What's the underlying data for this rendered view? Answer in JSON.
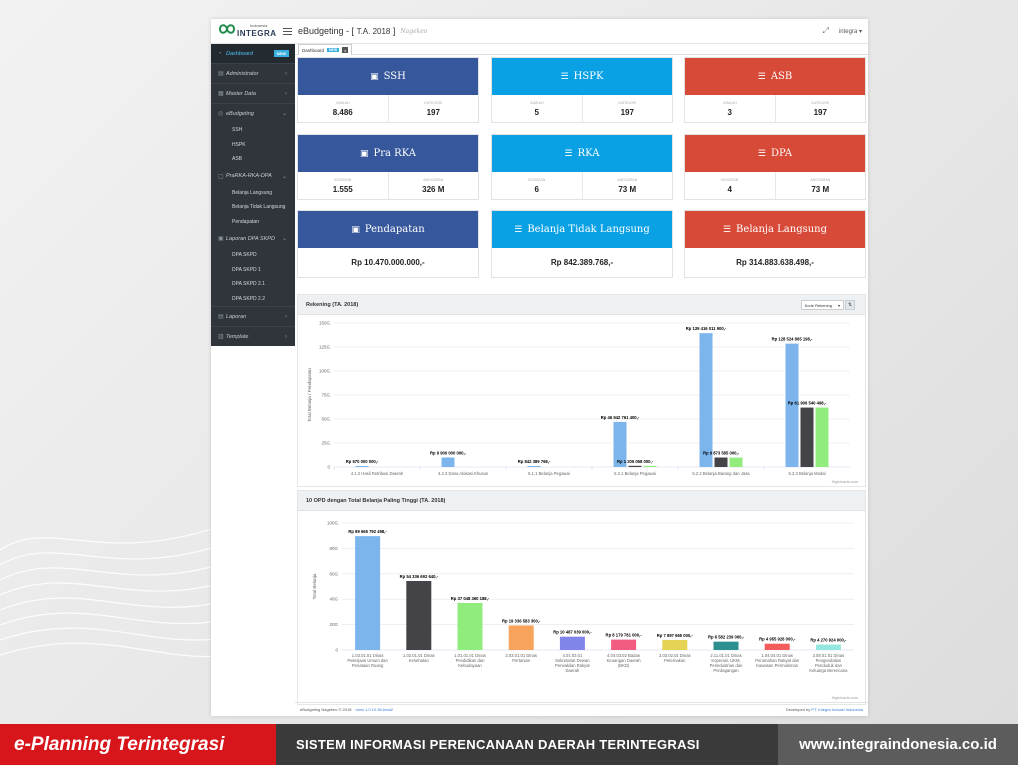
{
  "header": {
    "logo_top": "Indonesia",
    "logo_name": "INTEGRA",
    "title": "eBudgeting - [",
    "title_ta": "T.A. 2018",
    "title_close": "]",
    "subtitle": "Nagekeo",
    "user": "integra"
  },
  "sidebar": {
    "items": [
      {
        "label": "Dashboard",
        "badge": "NEW"
      },
      {
        "label": "Administrator"
      },
      {
        "label": "Master Data"
      },
      {
        "label": "eBudgeting"
      },
      {
        "label": "SSH"
      },
      {
        "label": "HSPK"
      },
      {
        "label": "ASB"
      },
      {
        "label": "PraRKA-RKA-DPA"
      },
      {
        "label": "Belanja Langsung"
      },
      {
        "label": "Belanja Tidak Langsung"
      },
      {
        "label": "Pendapatan"
      },
      {
        "label": "Laporan DPA SKPD"
      },
      {
        "label": "DPA SKPD"
      },
      {
        "label": "DPA SKPD 1"
      },
      {
        "label": "DPA SKPD 2.1"
      },
      {
        "label": "DPA SKPD 2.2"
      },
      {
        "label": "Laporan"
      },
      {
        "label": "Template"
      }
    ]
  },
  "tabs": [
    {
      "label": "Dashboard",
      "badge": "NEW",
      "close": "x"
    }
  ],
  "cards": [
    {
      "title": "SSH",
      "color": "#36579b",
      "left_label": "JUMLAH",
      "left_value": "8.486",
      "right_label": "KATEGORI",
      "right_value": "197"
    },
    {
      "title": "HSPK",
      "color": "#0aa1e4",
      "left_label": "JUMLAH",
      "left_value": "5",
      "right_label": "KATEGORI",
      "right_value": "197"
    },
    {
      "title": "ASB",
      "color": "#d84a38",
      "left_label": "JUMLAH",
      "left_value": "3",
      "right_label": "KATEGORI",
      "right_value": "197"
    },
    {
      "title": "Pra RKA",
      "color": "#36579b",
      "left_label": "KEGIATAN",
      "left_value": "1.555",
      "right_label": "ANGGARAN",
      "right_value": "326 M"
    },
    {
      "title": "RKA",
      "color": "#0aa1e4",
      "left_label": "KEGIATAN",
      "left_value": "6",
      "right_label": "ANGGARAN",
      "right_value": "73 M"
    },
    {
      "title": "DPA",
      "color": "#d84a38",
      "left_label": "KEGIATAN",
      "left_value": "4",
      "right_label": "ANGGARAN",
      "right_value": "73 M"
    },
    {
      "title": "Pendapatan",
      "color": "#36579b",
      "total": "Rp 10.470.000.000,-"
    },
    {
      "title": "Belanja Tidak Langsung",
      "color": "#0aa1e4",
      "total": "Rp 842.389.768,-"
    },
    {
      "title": "Belanja Langsung",
      "color": "#d84a38",
      "total": "Rp 314.883.638.498,-"
    }
  ],
  "panel1": {
    "title": "Rekening (TA. 2018)",
    "select": "Kode Rekening"
  },
  "panel2": {
    "title": "10 OPD dengan Total Belanja Paling Tinggi (TA. 2018)"
  },
  "chart_data": [
    {
      "type": "bar",
      "title": "",
      "ylabel": "Total Belanja / Pendapatan",
      "ylim": [
        0,
        150
      ],
      "yticks": [
        "0",
        "25G",
        "50G",
        "75G",
        "100G",
        "125G",
        "150G"
      ],
      "credit": "Highcharts.com",
      "categories": [
        "4.1.2 Hasil Retribusi Daerah",
        "4.2.3 Dana Alokasi Khusus",
        "5.1.1 Belanja Pegawai",
        "5.2.1 Belanja Pegawai",
        "5.2.2 Belanja Barang dan Jasa",
        "5.2.3 Belanja Modal"
      ],
      "series": [
        {
          "color": "#7cb5ec",
          "values": [
            0.57,
            9.9,
            0.842,
            46.94,
            139.42,
            128.52
          ],
          "labels": [
            "Rp 570 000 000,-",
            "Rp 9 900 000 000,-",
            "Rp 842 389 768,-",
            "Rp 46 942 761 400,-",
            "Rp 139 416 011 900,-",
            "Rp 128 524 865 198,-"
          ]
        },
        {
          "color": "#434348",
          "values": [
            0,
            0,
            0,
            1.21,
            9.87,
            61.91
          ],
          "labels": [
            "",
            "",
            "",
            "Rp 1 205 058 000,-",
            "Rp 9 873 585 000,-",
            "Rp 61 906 540 498,-"
          ]
        },
        {
          "color": "#90ed7d",
          "values": [
            0,
            0,
            0,
            1.2,
            9.8,
            61.9
          ],
          "labels": [
            "",
            "",
            "",
            "",
            "",
            ""
          ]
        }
      ]
    },
    {
      "type": "bar",
      "title": "",
      "ylabel": "Total Belanja",
      "ylim": [
        0,
        100
      ],
      "yticks": [
        "0",
        "20G",
        "40G",
        "60G",
        "80G",
        "100G"
      ],
      "credit": "Highcharts.com",
      "categories": [
        "1.03.01.01 Dinas Pekerjaan Umum dan Penataan Ruang",
        "1.02.01.01 Dinas Kesehatan",
        "1.01.01.01 Dinas Pendidikan dan Kebudayaan",
        "3.03.01.01 Dinas Pertanian",
        "4.01.03.01 Sekretariat Dewan Perwakilan Rakyat Daerah",
        "4.04.03.02 Badan Keuangan Daerah (BKD)",
        "3.03.02.01 Dinas Peternakan",
        "2.11.01.01 Dinas Koperasi, UKM, Perindustrian dan Perdagangan",
        "1.04.04.01 Dinas Perumahan Rakyat dan Kawasan Permukiman",
        "2.08.01.01 Dinas Pengendalian Penduduk dan Keluarga Berencana"
      ],
      "values": [
        89.67,
        54.34,
        37.05,
        19.34,
        10.49,
        8.18,
        7.9,
        6.58,
        4.96,
        4.27
      ],
      "labels": [
        "Rp 89 665 792 498,-",
        "Rp 54 336 692 640,-",
        "Rp 37 048 360 188,-",
        "Rp 19 336 583 300,-",
        "Rp 10 487 039 000,-",
        "Rp 8 179 781 000,-",
        "Rp 7 897 665 000,-",
        "Rp 6 582 239 000,-",
        "Rp 4 955 926 000,-",
        "Rp 4 270 924 000,-"
      ],
      "colors": [
        "#7cb5ec",
        "#434348",
        "#90ed7d",
        "#f7a35c",
        "#8085e9",
        "#f15c80",
        "#e4d354",
        "#2b908f",
        "#f45b5b",
        "#91e8e1"
      ]
    }
  ],
  "footer": {
    "copy": "eBudgeting Nagekeo © 2018",
    "version": "versi 1.0.10.36-beta2",
    "dev_prefix": "Developed by",
    "dev_name": "PT. Integra Inovasi Indonesia"
  },
  "banner": {
    "left": "e-Planning Terintegrasi",
    "middle": "SISTEM INFORMASI PERENCANAAN DAERAH TERINTEGRASI",
    "right": "www.integraindonesia.co.id"
  }
}
